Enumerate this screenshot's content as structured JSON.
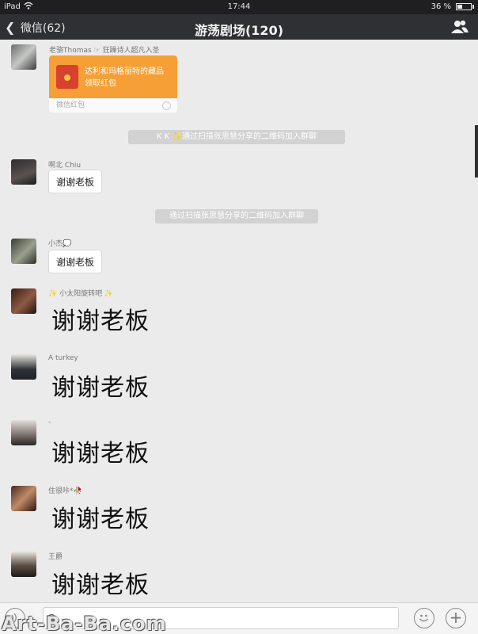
{
  "status_bar": {
    "carrier": "iPad",
    "time": "17:44",
    "battery": "36 %"
  },
  "nav": {
    "back_label": "微信(62)",
    "title": "游荡剧场(120)"
  },
  "red_packet": {
    "sender": "老骆Thomas ☞ 狂躁诗人超凡入圣",
    "message_line1": "达利和玛格丽特的藏品",
    "message_line2": "领取红包",
    "footer": "微信红包",
    "color": "#f59f36"
  },
  "system_messages": [
    "K  K  ✨通过扫描张思慧分享的二维码加入群聊",
    "通过扫描张思慧分享的二维码加入群聊"
  ],
  "messages": [
    {
      "sender": "啊北 Chiu",
      "text": "谢谢老板"
    },
    {
      "sender": "小杰💭",
      "text": "谢谢老板"
    },
    {
      "sender": "✨ 小太阳旋转吧 ✨",
      "text": "谢谢老板"
    },
    {
      "sender": "A turkey",
      "text": "谢谢老板"
    },
    {
      "sender": "-",
      "text": "谢谢老板"
    },
    {
      "sender": "住很咔*🥀",
      "text": "谢谢老板"
    },
    {
      "sender": "王爵",
      "text": "谢谢老板"
    }
  ],
  "input": {
    "value": "@"
  },
  "watermark": "Art-Ba-Ba.com",
  "icons": {
    "back": "chevron-left-icon",
    "members": "group-members-icon",
    "voice": "voice-icon",
    "emoji": "emoji-icon",
    "plus": "plus-icon",
    "wifi": "wifi-icon",
    "battery": "battery-icon"
  }
}
